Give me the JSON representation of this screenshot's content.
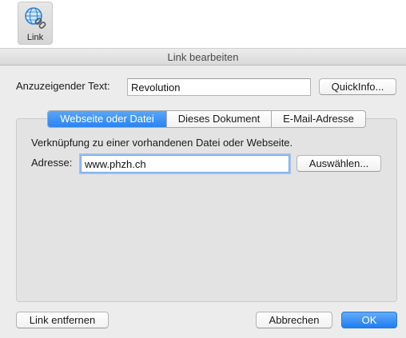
{
  "toolbar": {
    "link_label": "Link",
    "link_icon": "globe-chain-icon"
  },
  "dialog": {
    "title": "Link bearbeiten",
    "display_text_label": "Anzuzeigender Text:",
    "display_text_value": "Revolution",
    "quickinfo_button": "QuickInfo...",
    "tabs": [
      {
        "label": "Webseite oder Datei",
        "active": true
      },
      {
        "label": "Dieses Dokument",
        "active": false
      },
      {
        "label": "E-Mail-Adresse",
        "active": false
      }
    ],
    "description": "Verknüpfung zu einer vorhandenen Datei oder Webseite.",
    "address_label": "Adresse:",
    "address_value": "www.phzh.ch",
    "choose_button": "Auswählen...",
    "remove_link_button": "Link entfernen",
    "cancel_button": "Abbrechen",
    "ok_button": "OK"
  },
  "colors": {
    "accent": "#2a84f2",
    "background": "#ececec",
    "panel": "#e3e3e3"
  }
}
